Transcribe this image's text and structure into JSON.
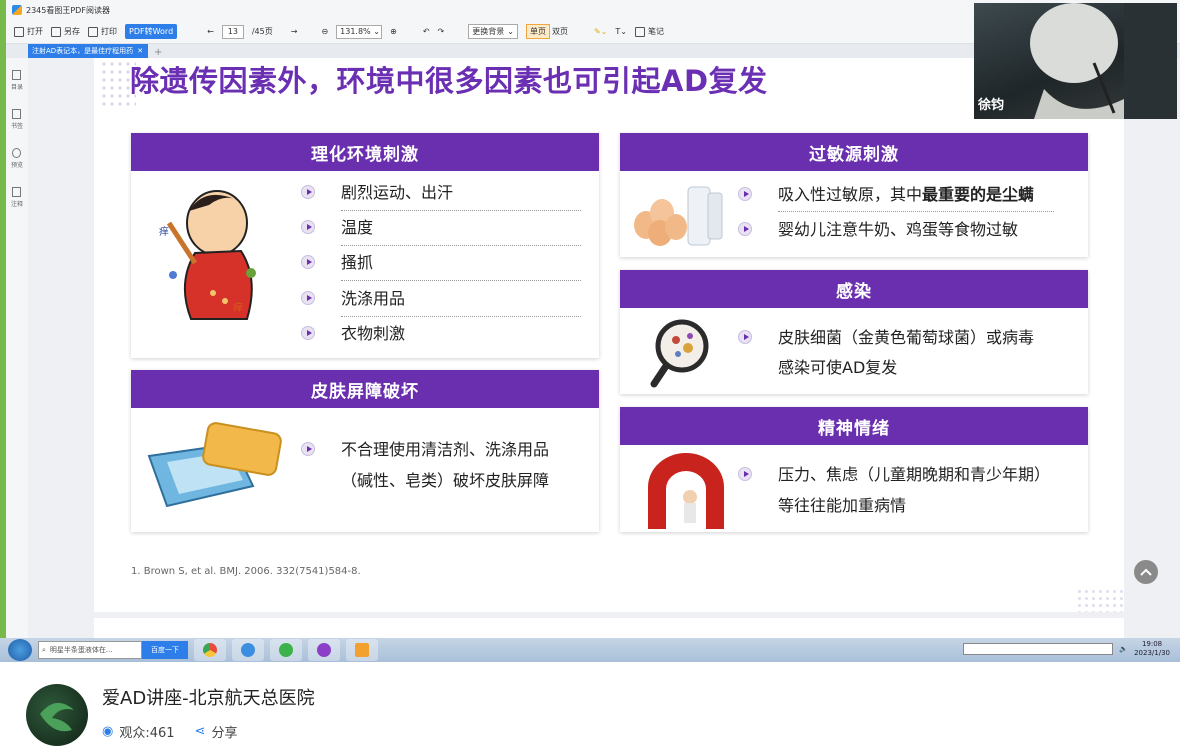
{
  "window": {
    "title": "2345看图王PDF阅读器"
  },
  "toolbar": {
    "open": "打开",
    "save_as": "另存",
    "print": "打印",
    "pdf_to_word": "PDF转Word",
    "page_current": "13",
    "page_total": "/45页",
    "zoom": "131.8%",
    "background": "更换背景",
    "single_page": "单页",
    "double_page": "双页",
    "notes": "笔记"
  },
  "tabs": [
    {
      "label": "注射AD表记本，是最佳疗程用药"
    }
  ],
  "sidebar": {
    "items": [
      "目录",
      "书签",
      "预览",
      "注释"
    ]
  },
  "slide": {
    "title": "除遗传因素外，环境中很多因素也可引起AD复发",
    "cards": {
      "physical": {
        "header": "理化环境刺激",
        "items": [
          "剧烈运动、出汗",
          "温度",
          "搔抓",
          "洗涤用品",
          "衣物刺激"
        ]
      },
      "barrier": {
        "header": "皮肤屏障破坏",
        "line1": "不合理使用清洁剂、洗涤用品",
        "line2": "（碱性、皂类）破坏皮肤屏障"
      },
      "allergen": {
        "header": "过敏源刺激",
        "item1_pre": "吸入性过敏原，其中",
        "item1_bold": "最重要的是尘螨",
        "item2": "婴幼儿注意牛奶、鸡蛋等食物过敏"
      },
      "infection": {
        "header": "感染",
        "line1": "皮肤细菌（金黄色葡萄球菌）或病毒",
        "line2": "感染可使AD复发"
      },
      "mental": {
        "header": "精神情绪",
        "line1": "压力、焦虑（儿童期晚期和青少年期）",
        "line2": "等往往能加重病情"
      }
    },
    "citation": "1. Brown S, et al. BMJ. 2006. 332(7541)584-8."
  },
  "webcam": {
    "name": "徐钧"
  },
  "taskbar": {
    "search_placeholder": "明星半条蛋液体在...",
    "search_button": "百度一下",
    "time": "19:08",
    "date": "2023/1/30"
  },
  "stream": {
    "title": "爱AD讲座-北京航天总医院",
    "viewers": "观众:461",
    "share": "分享"
  }
}
